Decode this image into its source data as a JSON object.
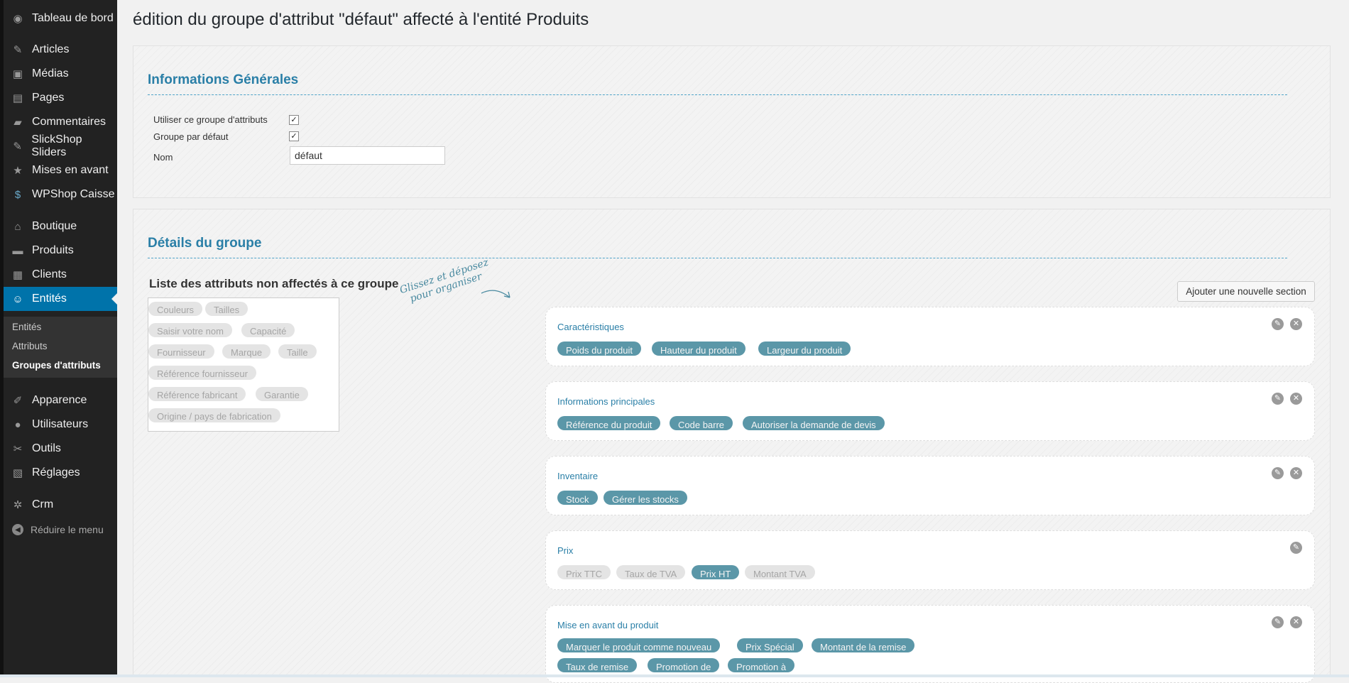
{
  "sidebar": {
    "items": [
      {
        "label": "Tableau de bord",
        "icon": "dashboard-icon",
        "glyph": "◉"
      },
      {
        "label": "Articles",
        "icon": "pin-icon",
        "glyph": "✎"
      },
      {
        "label": "Médias",
        "icon": "media-icon",
        "glyph": "▣"
      },
      {
        "label": "Pages",
        "icon": "pages-icon",
        "glyph": "▤"
      },
      {
        "label": "Commentaires",
        "icon": "comments-icon",
        "glyph": "▰"
      },
      {
        "label": "SlickShop Sliders",
        "icon": "pin-icon",
        "glyph": "✎"
      },
      {
        "label": "Mises en avant",
        "icon": "star-icon",
        "glyph": "★"
      },
      {
        "label": "WPShop Caisse",
        "icon": "dollar-icon",
        "glyph": "$"
      },
      {
        "label": "Boutique",
        "icon": "home-icon",
        "glyph": "⌂"
      },
      {
        "label": "Produits",
        "icon": "products-icon",
        "glyph": "▬"
      },
      {
        "label": "Clients",
        "icon": "clients-icon",
        "glyph": "▦"
      },
      {
        "label": "Entités",
        "icon": "accessibility-icon",
        "glyph": "☺"
      },
      {
        "label": "Apparence",
        "icon": "appearance-icon",
        "glyph": "✐"
      },
      {
        "label": "Utilisateurs",
        "icon": "users-icon",
        "glyph": "●"
      },
      {
        "label": "Outils",
        "icon": "tools-icon",
        "glyph": "✂"
      },
      {
        "label": "Réglages",
        "icon": "settings-icon",
        "glyph": "▧"
      },
      {
        "label": "Crm",
        "icon": "gear-icon",
        "glyph": "✲"
      }
    ],
    "submenu": [
      "Entités",
      "Attributs",
      "Groupes d'attributs"
    ],
    "collapse_label": "Réduire le menu",
    "collapse_glyph": "◀"
  },
  "page_title": "édition du groupe d'attribut \"défaut\" affecté à l'entité Produits",
  "general": {
    "title": "Informations Générales",
    "use_group_label": "Utiliser ce groupe d'attributs",
    "default_group_label": "Groupe par défaut",
    "name_label": "Nom",
    "name_value": "défaut",
    "check_mark": "✓"
  },
  "details": {
    "title": "Détails du groupe",
    "unassigned_title": "Liste des attributs non affectés à ce groupe",
    "unassigned": [
      "Couleurs",
      "Tailles",
      "Saisir votre nom",
      "Capacité",
      "Fournisseur",
      "Marque",
      "Taille",
      "Référence fournisseur",
      "Référence fabricant",
      "Garantie",
      "Origine / pays de fabrication"
    ],
    "hint_line1": "Glissez et déposez",
    "hint_line2": "pour organiser",
    "add_section_label": "Ajouter une nouvelle section",
    "edit_glyph": "✎",
    "delete_glyph": "✕",
    "sections": [
      {
        "title": "Caractéristiques",
        "attributes": [
          "Poids du produit",
          "Hauteur du produit",
          "Largeur du produit"
        ]
      },
      {
        "title": "Informations principales",
        "attributes": [
          "Référence du produit",
          "Code barre",
          "Autoriser la demande de devis"
        ]
      },
      {
        "title": "Inventaire",
        "attributes": [
          "Stock",
          "Gérer les stocks"
        ]
      },
      {
        "title": "Prix",
        "attributes": [
          "Prix TTC",
          "Taux de TVA",
          "Prix HT",
          "Montant TVA"
        ]
      },
      {
        "title": "Mise en avant du produit",
        "attributes": [
          "Marquer le produit comme nouveau",
          "Prix Spécial",
          "Montant de la remise",
          "Taux de remise",
          "Promotion de",
          "Promotion à"
        ]
      }
    ]
  },
  "colors": {
    "accent": "#0073aa",
    "chip_blue": "#5b97a8",
    "heading": "#2a7fa7"
  }
}
